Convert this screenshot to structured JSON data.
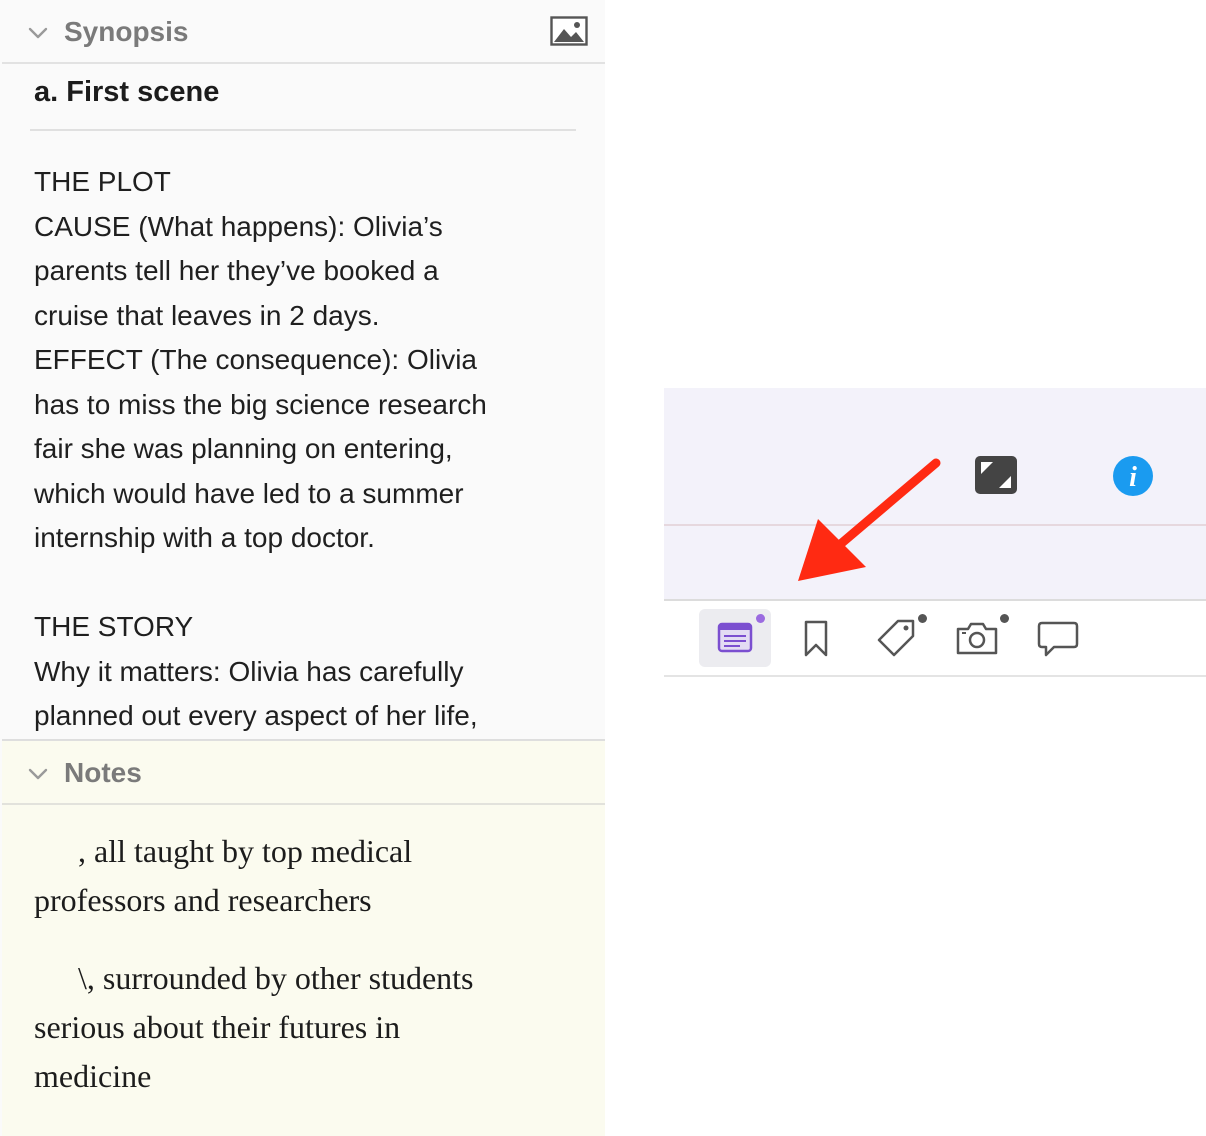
{
  "synopsis": {
    "header_label": "Synopsis",
    "scene_title": "a. First scene",
    "lines": [
      "THE PLOT",
      "CAUSE (What happens): Olivia’s",
      "parents tell her they’ve booked a",
      "cruise that leaves in 2 days.",
      "EFFECT (The consequence): Olivia",
      "has to miss the big science research",
      "fair she was planning on entering,",
      "which would have led to a summer",
      "internship with a top doctor.",
      "",
      "THE STORY",
      "Why it matters: Olivia has carefully",
      "planned out every aspect of her life,"
    ]
  },
  "notes": {
    "header_label": "Notes",
    "paragraphs": [
      [
        ", all taught by top medical",
        "professors and researchers"
      ],
      [
        "\\, surrounded by other students",
        "serious about their futures in",
        "medicine"
      ]
    ]
  },
  "toolbar": {
    "tabs": [
      {
        "icon": "synopsis-card-icon",
        "selected": true,
        "has_dot": true
      },
      {
        "icon": "bookmark-icon",
        "selected": false,
        "has_dot": false
      },
      {
        "icon": "tag-icon",
        "selected": false,
        "has_dot": true
      },
      {
        "icon": "camera-icon",
        "selected": false,
        "has_dot": true
      },
      {
        "icon": "comment-icon",
        "selected": false,
        "has_dot": false
      }
    ]
  },
  "colors": {
    "accent_purple": "#7b4fd0",
    "info_blue": "#1a9bf0",
    "arrow_red": "#ff2a12",
    "notes_background": "#fbfbef"
  }
}
